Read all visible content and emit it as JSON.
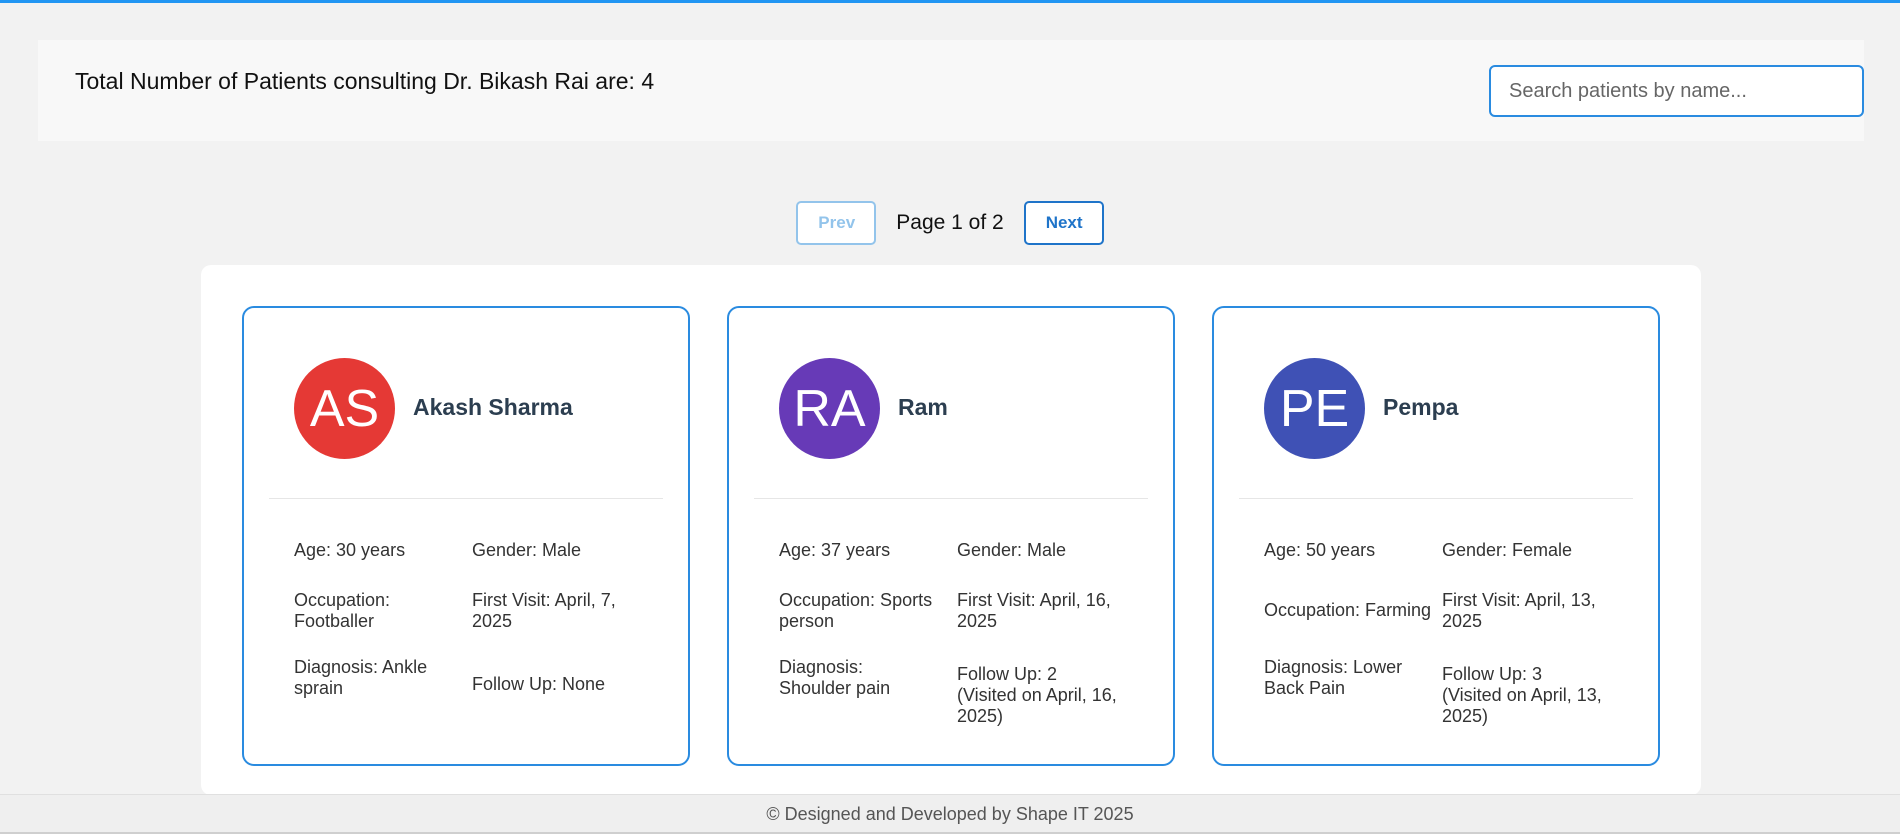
{
  "header": {
    "title": "Total Number of Patients consulting Dr. Bikash Rai are: 4",
    "search_placeholder": "Search patients by name..."
  },
  "pagination": {
    "prev_label": "Prev",
    "page_info": "Page 1 of 2",
    "next_label": "Next"
  },
  "patients": [
    {
      "initials": "AS",
      "name": "Akash Sharma",
      "avatar_color": "#e53935",
      "age": "Age: 30 years",
      "gender": "Gender: Male",
      "occupation": "Occupation: Footballer",
      "first_visit": "First Visit: April, 7, 2025",
      "diagnosis": "Diagnosis: Ankle sprain",
      "follow_up": "Follow Up: None"
    },
    {
      "initials": "RA",
      "name": "Ram",
      "avatar_color": "#673ab7",
      "age": "Age: 37 years",
      "gender": "Gender: Male",
      "occupation": "Occupation: Sports person",
      "first_visit": "First Visit: April, 16, 2025",
      "diagnosis": "Diagnosis: Shoulder pain",
      "follow_up": "Follow Up: 2 (Visited on April, 16, 2025)"
    },
    {
      "initials": "PE",
      "name": "Pempa",
      "avatar_color": "#3f51b5",
      "age": "Age: 50 years",
      "gender": "Gender: Female",
      "occupation": "Occupation: Farming",
      "first_visit": "First Visit: April, 13, 2025",
      "diagnosis": "Diagnosis: Lower Back Pain",
      "follow_up": "Follow Up: 3 (Visited on April, 13, 2025)"
    }
  ],
  "footer": {
    "text": "© Designed and Developed by Shape IT 2025"
  },
  "colors": {
    "accent": "#2196f3",
    "card_border": "#2a8be0",
    "prev_disabled": "#93c4eb",
    "next": "#1f74c9"
  }
}
